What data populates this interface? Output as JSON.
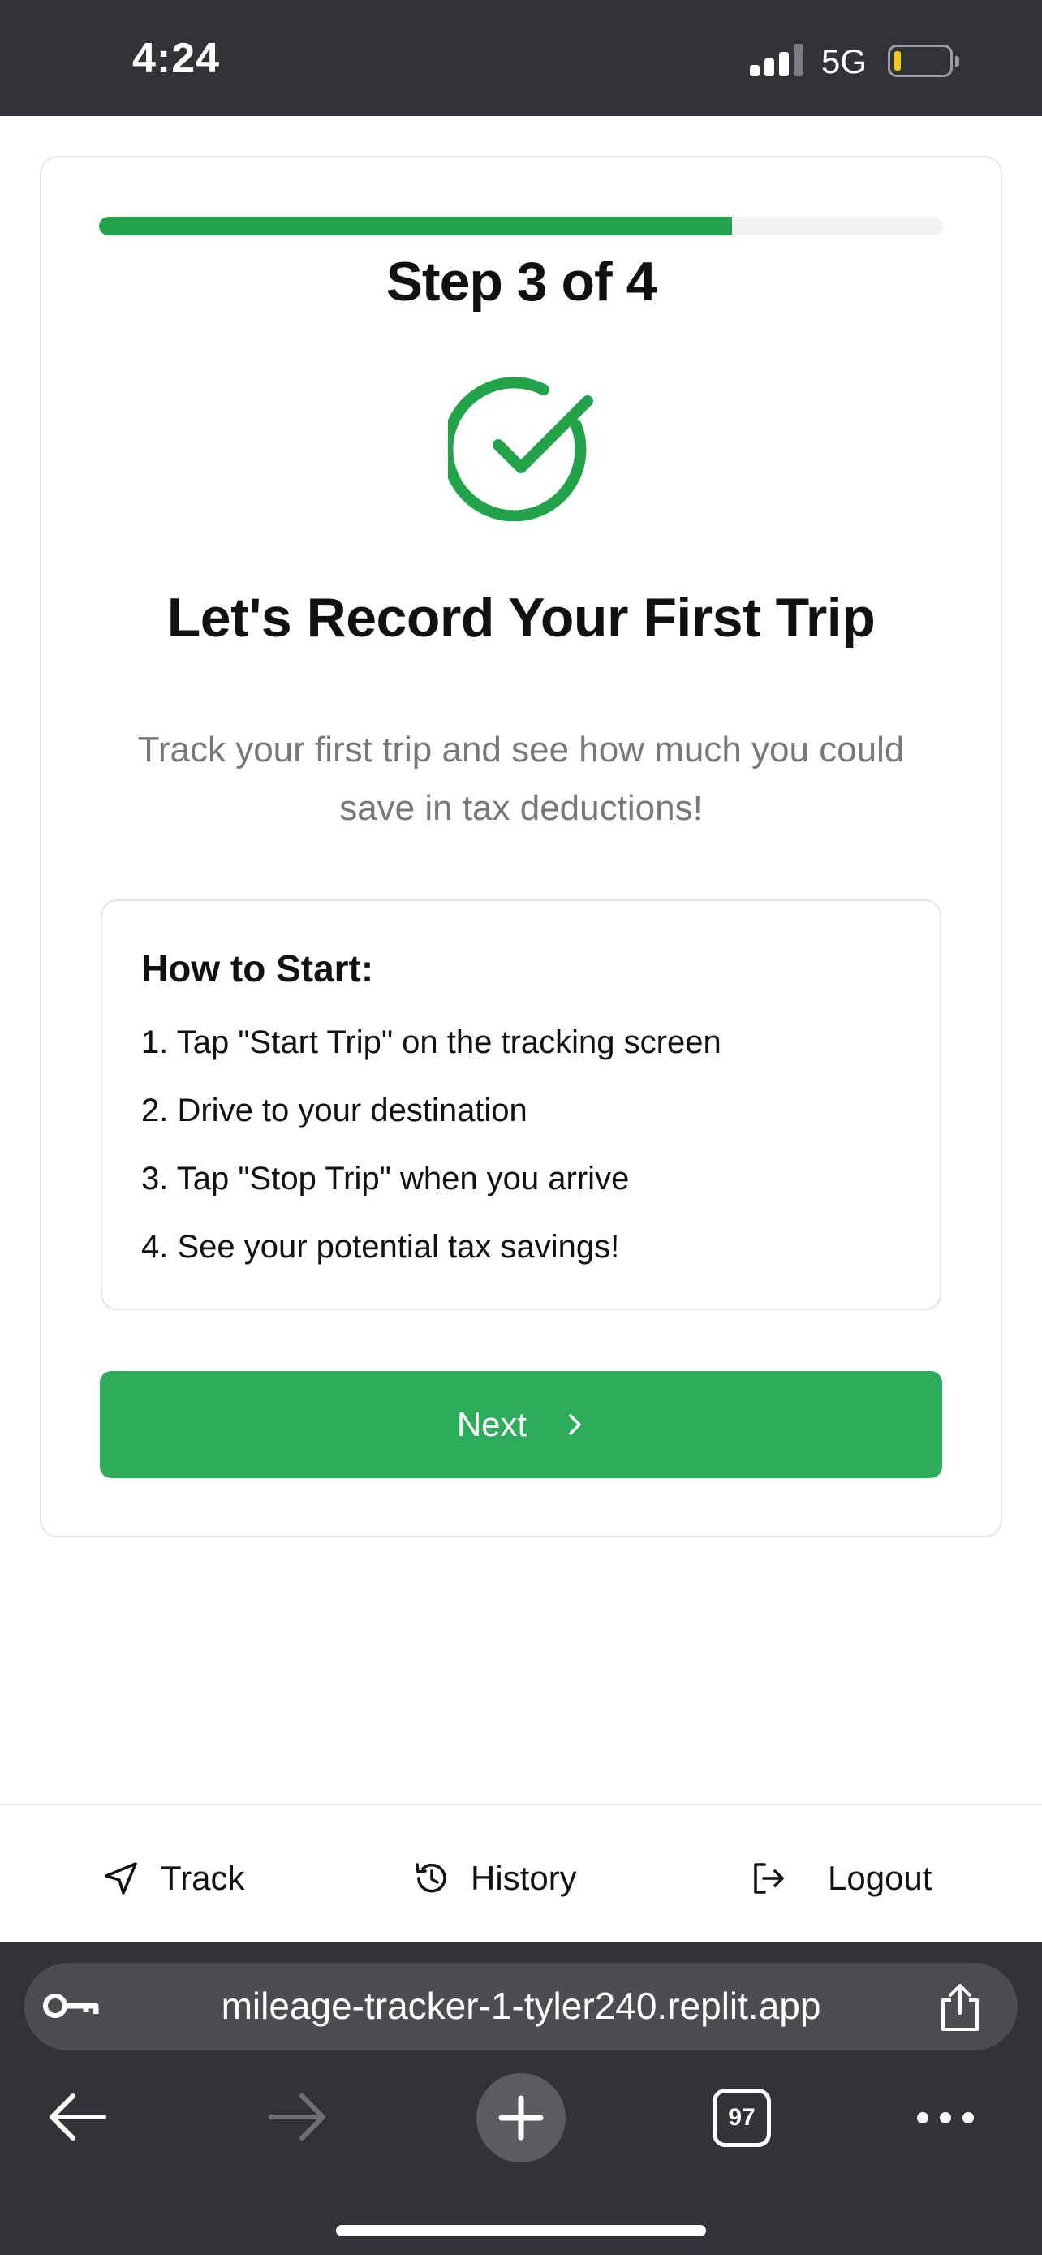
{
  "status_bar": {
    "time": "4:24",
    "network": "5G",
    "battery_level": 0.1,
    "battery_color": "#f5c518"
  },
  "onboarding": {
    "progress": 0.75,
    "step_label": "Step 3 of 4",
    "icon": "check-circle-icon",
    "headline": "Let's Record Your First Trip",
    "subtitle": "Track your first trip and see how much you could save in tax deductions!",
    "how_to": {
      "title": "How to Start:",
      "steps": [
        "1. Tap \"Start Trip\" on the tracking screen",
        "2. Drive to your destination",
        "3. Tap \"Stop Trip\" when you arrive",
        "4. See your potential tax savings!"
      ]
    },
    "next_label": "Next",
    "accent_color": "#22a34a",
    "button_color": "#2dac5c"
  },
  "bottom_nav": {
    "items": [
      {
        "label": "Track",
        "icon": "navigation-arrow-icon"
      },
      {
        "label": "History",
        "icon": "history-icon"
      },
      {
        "label": "Logout",
        "icon": "logout-icon"
      }
    ]
  },
  "browser": {
    "url": "mileage-tracker-1-tyler240.replit.app",
    "tab_count": "97"
  }
}
